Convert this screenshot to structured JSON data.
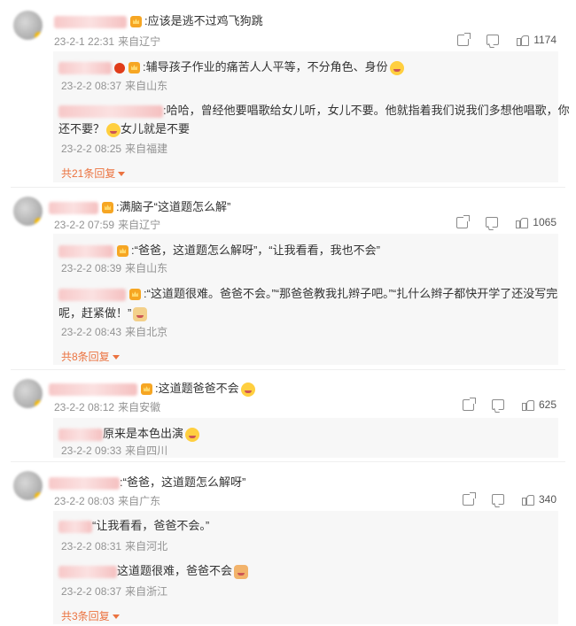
{
  "comments": [
    {
      "text": ":应该是逃不过鸡飞狗跳",
      "time": "23-2-1 22:31",
      "loc": "来自辽宁",
      "likes": "1174",
      "replies": [
        {
          "text": ":辅导孩子作业的痛苦人人平等，不分角色、身份",
          "time": "23-2-2 08:37",
          "loc": "来自山东"
        },
        {
          "text1": ":哈哈，曾经他要唱歌给女儿听，女儿不要。他就指着我们说我们多想他唱歌，你",
          "text2": "还不要？",
          "text3": "女儿就是不要",
          "time": "23-2-2 08:25",
          "loc": "来自福建"
        }
      ],
      "more": "共21条回复"
    },
    {
      "text": ":满脑子“这道题怎么解”",
      "time": "23-2-2 07:59",
      "loc": "来自辽宁",
      "likes": "1065",
      "replies": [
        {
          "text": ":“爸爸，这道题怎么解呀”，“让我看看，我也不会”",
          "time": "23-2-2 08:39",
          "loc": "来自山东"
        },
        {
          "text1": ":“这道题很难。爸爸不会。”“那爸爸教我扎辫子吧。”“扎什么辫子都快开学了还没写完",
          "text2": "呢，赶紧做！”",
          "time": "23-2-2 08:43",
          "loc": "来自北京"
        }
      ],
      "more": "共8条回复"
    },
    {
      "text": ":这道题爸爸不会",
      "time": "23-2-2 08:12",
      "loc": "来自安徽",
      "likes": "625",
      "replies": [
        {
          "text": "原来是本色出演",
          "time": "23-2-2 09:33",
          "loc": "来自四川"
        }
      ]
    },
    {
      "text": ":“爸爸，这道题怎么解呀”",
      "time": "23-2-2 08:03",
      "loc": "来自广东",
      "likes": "340",
      "replies": [
        {
          "text": "“让我看看，爸爸不会。”",
          "time": "23-2-2 08:31",
          "loc": "来自河北"
        },
        {
          "text": "这道题很难，爸爸不会",
          "time": "23-2-2 08:37",
          "loc": "来自浙江"
        }
      ],
      "more": "共3条回复"
    }
  ],
  "icons": {
    "share": "share-icon",
    "comment": "comment-icon",
    "like": "like-icon",
    "caret": "caret-down-icon"
  },
  "colors": {
    "link": "#eb7340",
    "meta": "#939393",
    "reply_bg": "#f7f7f7"
  }
}
